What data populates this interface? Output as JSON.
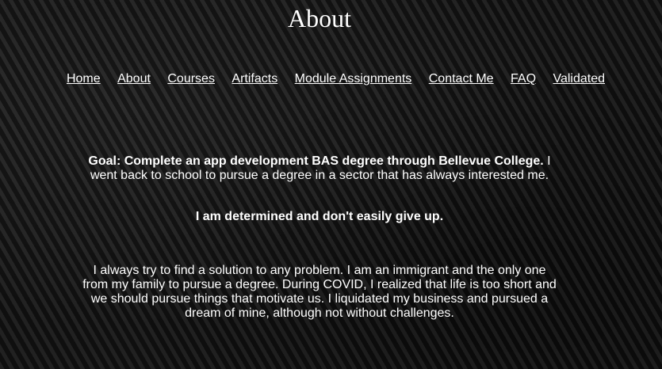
{
  "page": {
    "title": "About"
  },
  "nav": {
    "items": [
      {
        "label": "Home"
      },
      {
        "label": "About"
      },
      {
        "label": "Courses"
      },
      {
        "label": "Artifacts"
      },
      {
        "label": "Module Assignments"
      },
      {
        "label": "Contact Me"
      },
      {
        "label": "FAQ"
      },
      {
        "label": "Validated"
      }
    ]
  },
  "content": {
    "goal_bold": "Goal: Complete an app development BAS degree through Bellevue College.",
    "goal_rest": " I went back to school to pursue a degree in a sector that has always interested me.",
    "determined": "I am determined and don't easily give up.",
    "story": "I always try to find a solution to any problem. I am an immigrant and the only one from my family to pursue a degree. During COVID, I realized that life is too short and we should pursue things that motivate us. I liquidated my business and pursued a dream of mine, although not without challenges."
  },
  "colors": {
    "background": "#151515",
    "text": "#ffffff"
  }
}
